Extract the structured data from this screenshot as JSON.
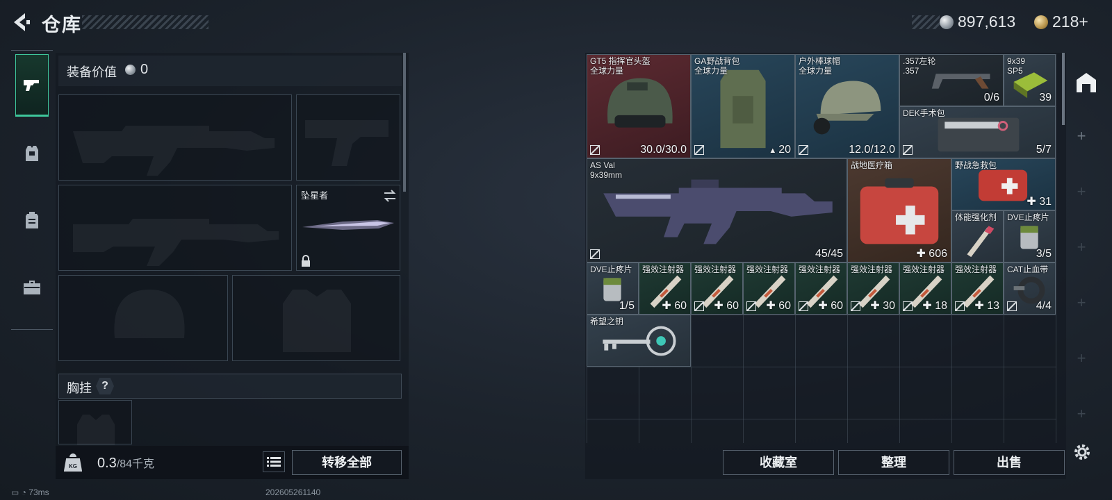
{
  "header": {
    "title": "仓库"
  },
  "currency": {
    "silver": "897,613",
    "gold": "218+"
  },
  "equipment": {
    "value_label": "装备价值",
    "value": "0",
    "melee_name": "坠星者",
    "chest_label": "胸挂",
    "chest_help": "?"
  },
  "weight": {
    "current": "0.3",
    "capacity": "/84千克",
    "icon_label": "KG"
  },
  "buttons": {
    "transfer_all": "转移全部",
    "collection": "收藏室",
    "sort": "整理",
    "sell": "出售"
  },
  "storage_items": [
    {
      "name": "GT5 指挥官头盔\n全球力量",
      "value": "30.0/30.0",
      "bg": "red",
      "locked": true
    },
    {
      "name": "GA野战背包\n全球力量",
      "value": "20",
      "bg": "blue",
      "locked": true,
      "value_prefix": "▲"
    },
    {
      "name": "户外棒球帽\n全球力量",
      "value": "12.0/12.0",
      "bg": "blue",
      "locked": true
    },
    {
      "name": ".357左轮\n.357",
      "value": "0/6",
      "bg": "dark",
      "locked": false
    },
    {
      "name": "9x39\nSP5",
      "value": "39",
      "bg": "gray",
      "locked": false
    },
    {
      "name": "DEK手术包",
      "value": "5/7",
      "bg": "gray",
      "locked": true
    },
    {
      "name": "AS Val\n9x39mm",
      "value": "45/45",
      "bg": "dark",
      "locked": true
    },
    {
      "name": "战地医疗箱",
      "value": "606",
      "bg": "brown",
      "locked": false,
      "plus": true
    },
    {
      "name": "野战急救包",
      "value": "31",
      "bg": "blue",
      "locked": false,
      "plus": true
    },
    {
      "name": "体能强化剂",
      "value": "",
      "bg": "gray",
      "locked": false
    },
    {
      "name": "DVE止疼片",
      "value": "3/5",
      "bg": "gray",
      "locked": false
    },
    {
      "name": "DVE止疼片",
      "value": "1/5",
      "bg": "gray",
      "locked": false
    },
    {
      "name": "强效注射器",
      "value": "60",
      "bg": "green",
      "locked": false,
      "plus": true
    },
    {
      "name": "强效注射器",
      "value": "60",
      "bg": "green",
      "locked": true,
      "plus": true
    },
    {
      "name": "强效注射器",
      "value": "60",
      "bg": "green",
      "locked": true,
      "plus": true
    },
    {
      "name": "强效注射器",
      "value": "60",
      "bg": "green",
      "locked": true,
      "plus": true
    },
    {
      "name": "强效注射器",
      "value": "30",
      "bg": "green",
      "locked": true,
      "plus": true
    },
    {
      "name": "强效注射器",
      "value": "18",
      "bg": "green",
      "locked": true,
      "plus": true
    },
    {
      "name": "强效注射器",
      "value": "13",
      "bg": "green",
      "locked": true,
      "plus": true
    },
    {
      "name": "CAT止血带",
      "value": "4/4",
      "bg": "gray",
      "locked": true
    },
    {
      "name": "希望之钥",
      "value": "",
      "bg": "gray",
      "locked": false
    }
  ],
  "status": {
    "ping": "73ms",
    "stamp": "202605261140"
  },
  "colors": {
    "accent": "#3ec79b",
    "bg": "#1c232c"
  }
}
